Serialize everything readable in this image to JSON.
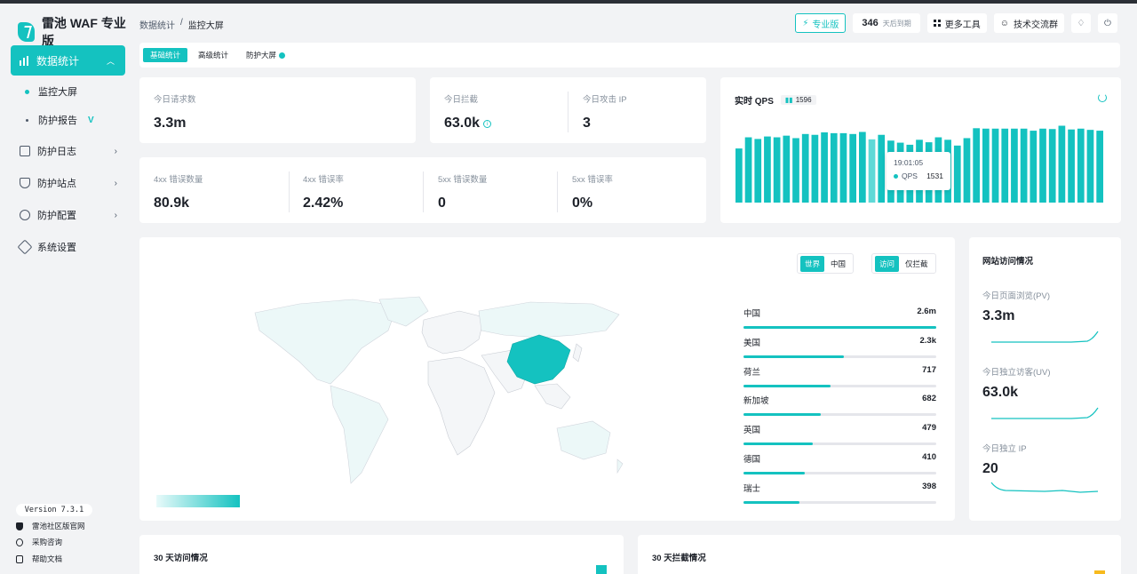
{
  "brand": {
    "name": "雷池 WAF 专业版",
    "accent": "#14c2c0"
  },
  "sidebar": {
    "active": {
      "label": "数据统计"
    },
    "sub_items": [
      {
        "label": "监控大屏"
      },
      {
        "label": "防护报告",
        "tag": "V"
      }
    ],
    "items": [
      {
        "label": "防护日志"
      },
      {
        "label": "防护站点"
      },
      {
        "label": "防护配置"
      },
      {
        "label": "系统设置"
      }
    ],
    "version": "Version 7.3.1",
    "footer_links": [
      {
        "label": "雷池社区版官网"
      },
      {
        "label": "采购咨询"
      },
      {
        "label": "帮助文档"
      }
    ]
  },
  "header": {
    "breadcrumb": [
      "数据统计",
      "/",
      "监控大屏"
    ],
    "pro_label": "专业版",
    "days_value": "346",
    "days_suffix": "天后到期",
    "more_tools": "更多工具",
    "community": "技术交流群"
  },
  "tabs": [
    {
      "label": "基础统计"
    },
    {
      "label": "高级统计"
    },
    {
      "label": "防护大屏"
    }
  ],
  "stats_top": [
    {
      "label": "今日请求数",
      "value": "3.3m"
    },
    {
      "label": "今日拦截",
      "value": "63.0k"
    },
    {
      "label": "今日攻击 IP",
      "value": "3"
    }
  ],
  "stats_errors": [
    {
      "label": "4xx 错误数量",
      "value": "80.9k"
    },
    {
      "label": "4xx 错误率",
      "value": "2.42%"
    },
    {
      "label": "5xx 错误数量",
      "value": "0"
    },
    {
      "label": "5xx 错误率",
      "value": "0%"
    }
  ],
  "qps": {
    "title": "实时 QPS",
    "badge": "1596",
    "tooltip": {
      "time": "19:01:05",
      "label": "QPS",
      "value": "1531"
    }
  },
  "chart_data": {
    "type": "bar",
    "title": "实时 QPS",
    "values": [
      1310,
      1580,
      1540,
      1600,
      1580,
      1620,
      1560,
      1660,
      1640,
      1700,
      1680,
      1680,
      1660,
      1710,
      1531,
      1640,
      1500,
      1450,
      1400,
      1520,
      1460,
      1580,
      1520,
      1380,
      1560,
      1800,
      1790,
      1790,
      1790,
      1790,
      1790,
      1740,
      1790,
      1780,
      1860,
      1770,
      1790,
      1760,
      1740
    ],
    "highlight_index": 14,
    "color": "#14c2c0",
    "highlight_color": "#5fd9d7"
  },
  "map": {
    "scope_toggle": [
      {
        "label": "世界",
        "on": true
      },
      {
        "label": "中国",
        "on": false
      }
    ],
    "mode_toggle": [
      {
        "label": "访问",
        "on": true
      },
      {
        "label": "仅拦截",
        "on": false
      }
    ],
    "countries": [
      {
        "name": "中国",
        "value": "2.6m",
        "ratio": 1.0
      },
      {
        "name": "美国",
        "value": "2.3k",
        "ratio": 0.52
      },
      {
        "name": "荷兰",
        "value": "717",
        "ratio": 0.45
      },
      {
        "name": "新加坡",
        "value": "682",
        "ratio": 0.4
      },
      {
        "name": "英国",
        "value": "479",
        "ratio": 0.36
      },
      {
        "name": "德国",
        "value": "410",
        "ratio": 0.32
      },
      {
        "name": "瑞士",
        "value": "398",
        "ratio": 0.29
      }
    ]
  },
  "site_visits": {
    "title": "网站访问情况",
    "blocks": [
      {
        "label": "今日页面浏览(PV)",
        "value": "3.3m"
      },
      {
        "label": "今日独立访客(UV)",
        "value": "63.0k"
      },
      {
        "label": "今日独立 IP",
        "value": "20"
      }
    ]
  },
  "bottom": {
    "visits_title": "30 天访问情况",
    "blocks_title": "30 天拦截情况"
  }
}
